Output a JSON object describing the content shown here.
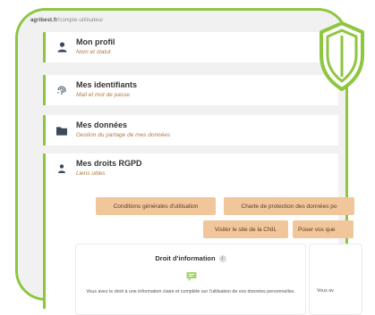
{
  "browser": {
    "url_host": "agribest.fr",
    "url_path": "/compte-utilisateur"
  },
  "sections": [
    {
      "title": "Mon profil",
      "subtitle": "Nom et statut",
      "icon": "person-icon"
    },
    {
      "title": "Mes identifiants",
      "subtitle": "Mail et mot de passe",
      "icon": "fingerprint-icon"
    },
    {
      "title": "Mes données",
      "subtitle": "Gestion du partage de mes données",
      "icon": "folder-icon"
    },
    {
      "title": "Mes droits RGPD",
      "subtitle": "Liens utiles",
      "icon": "user-shield-icon"
    }
  ],
  "rgpd_buttons": [
    "Conditions générales d'utilisation",
    "Charte de protection des données po",
    "Visiter le site de la CNIL",
    "Poser vos que"
  ],
  "info_card": {
    "title": "Droit d'information",
    "info_icon": "i",
    "text": "Vous avez le droit à une information claire et complète sur l'utilisation de vos données personnelles.",
    "icon": "chat-icon"
  },
  "info_card_partial": {
    "text": "Vous av"
  },
  "colors": {
    "accent": "#8dc63f",
    "button_bg": "#f0c69a",
    "subtitle": "#b07a45"
  },
  "badge": {
    "icon": "shield-icon"
  }
}
